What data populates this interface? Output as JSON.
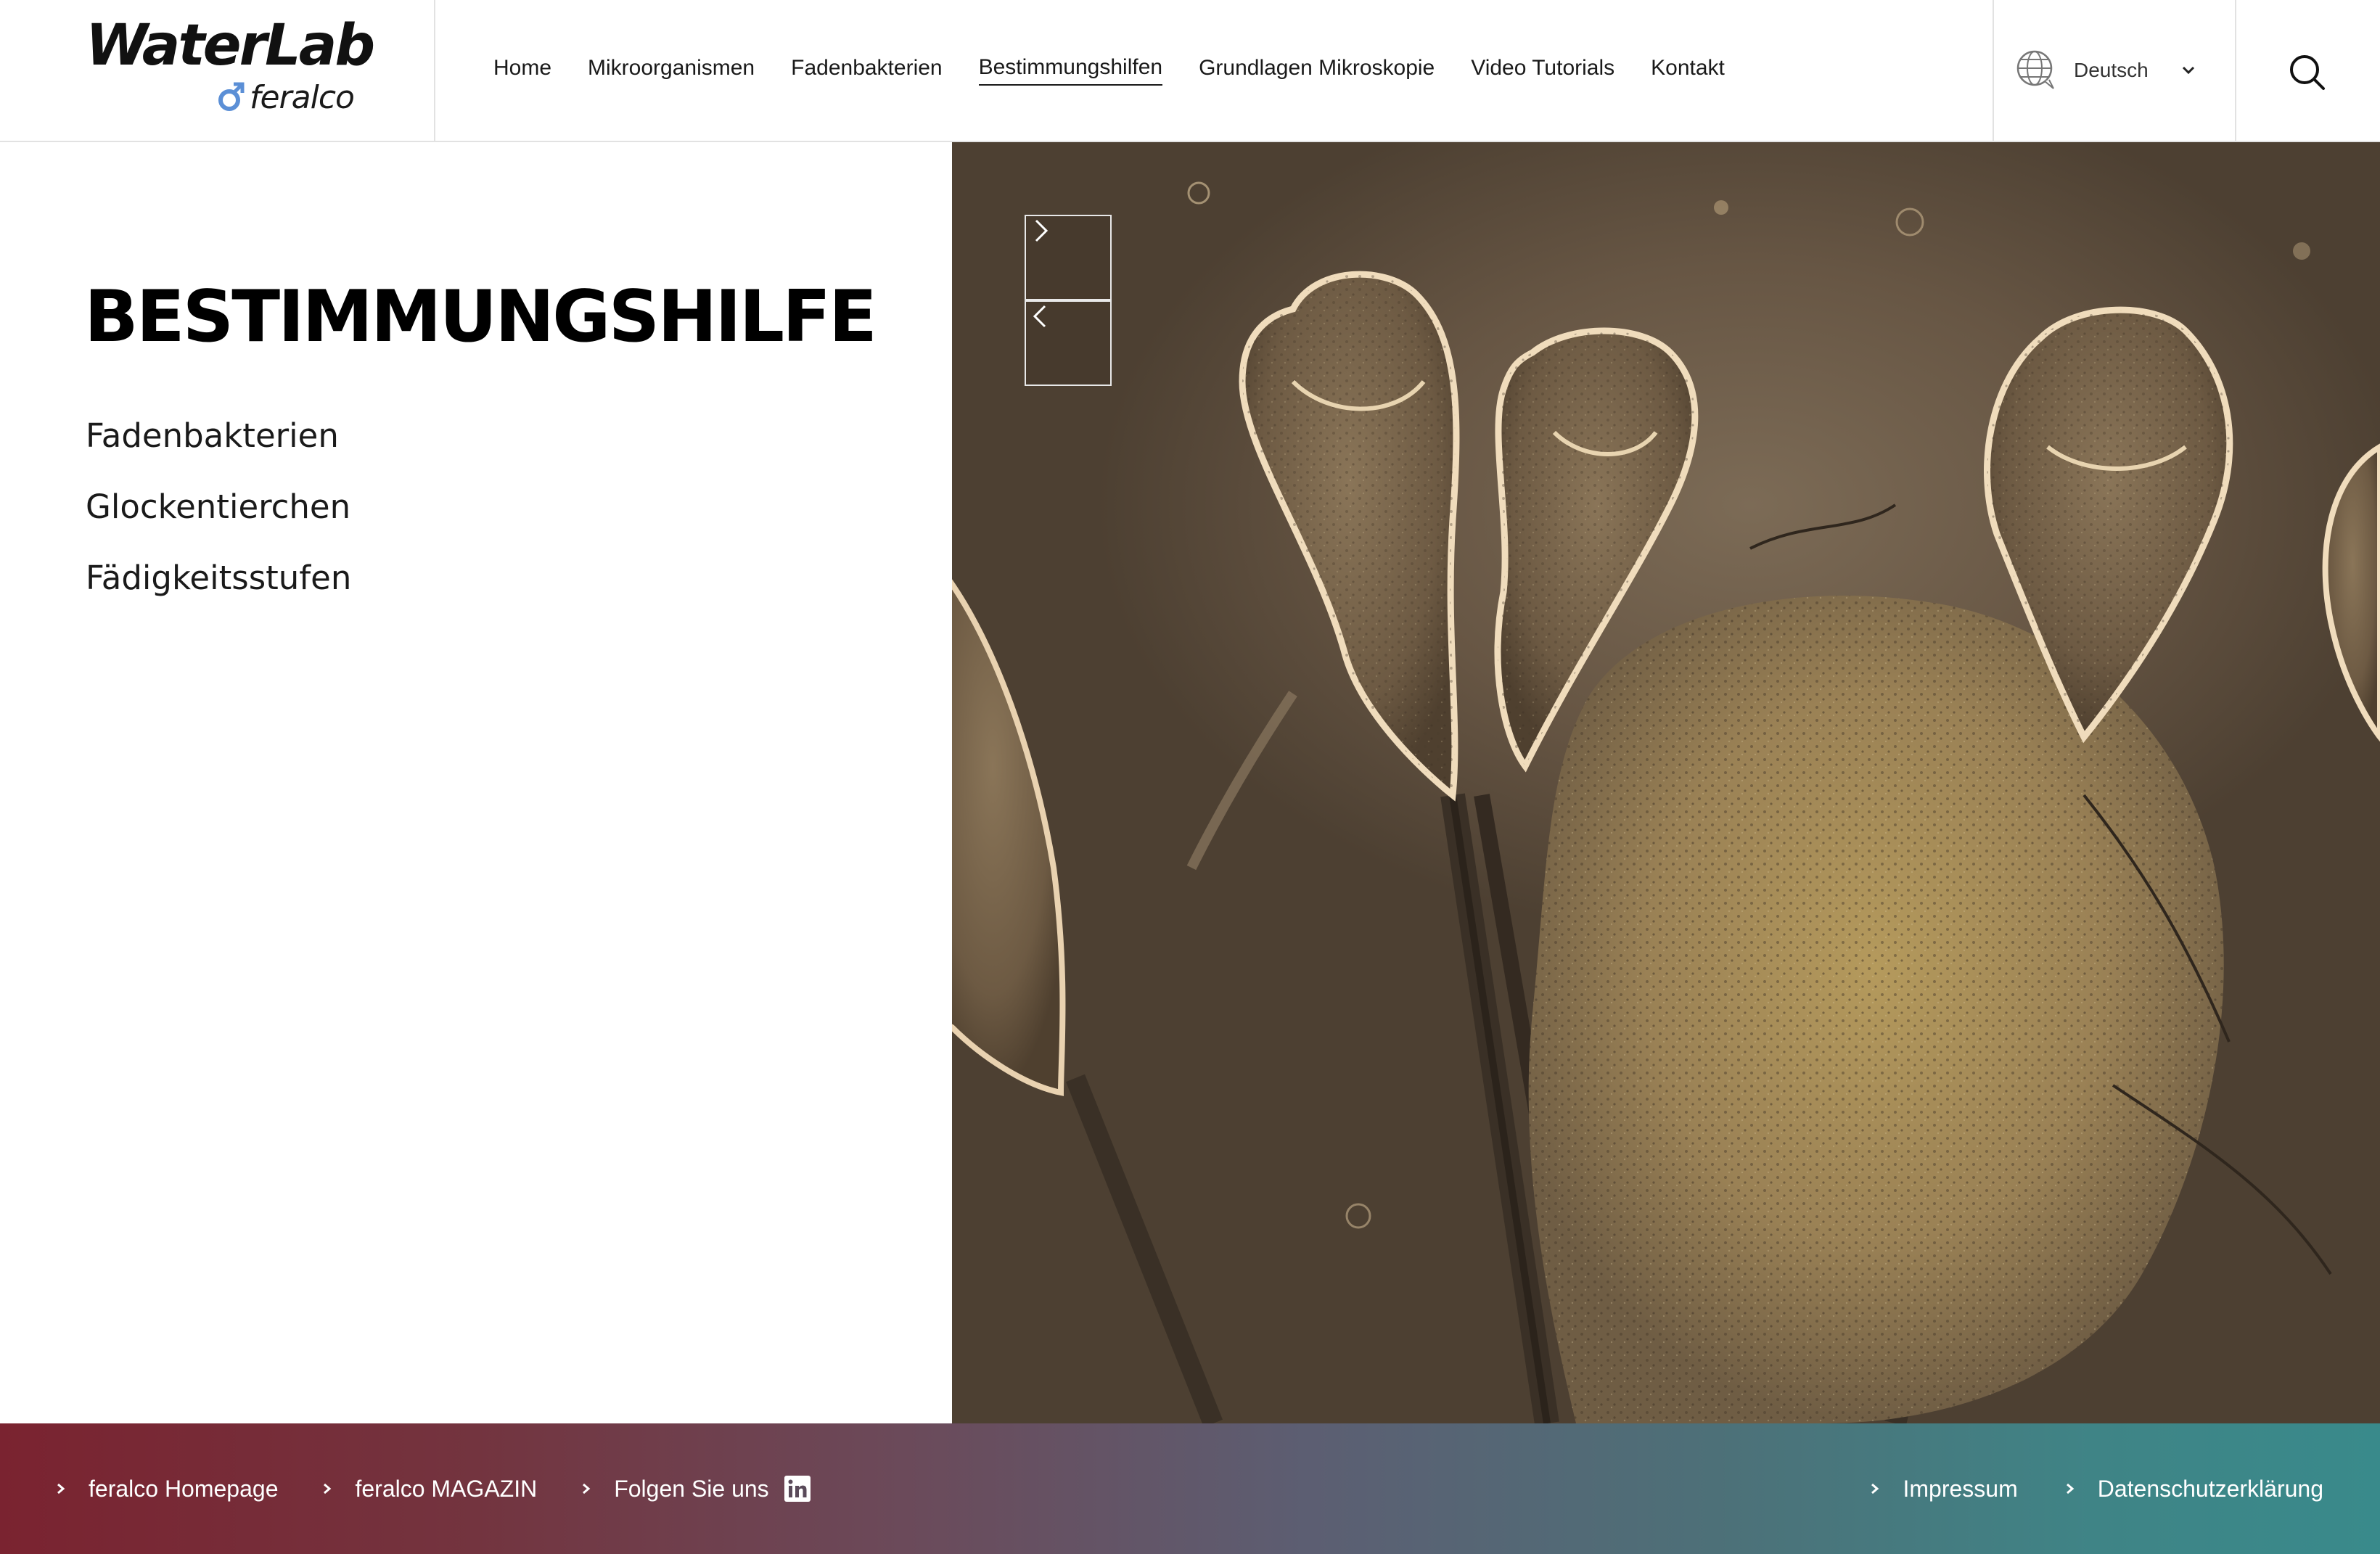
{
  "logo": {
    "main": "WaterLab",
    "sub": "feralco"
  },
  "nav": {
    "items": [
      "Home",
      "Mikroorganismen",
      "Fadenbakterien",
      "Bestimmungshilfen",
      "Grundlagen Mikroskopie",
      "Video Tutorials",
      "Kontakt"
    ],
    "active": "Bestimmungshilfen"
  },
  "language": {
    "selected": "Deutsch"
  },
  "page": {
    "title": "BESTIMMUNGSHILFE",
    "links": [
      "Fadenbakterien",
      "Glockentierchen",
      "Fädigkeitsstufen"
    ]
  },
  "footer": {
    "left": [
      "feralco Homepage",
      "feralco MAGAZIN",
      "Folgen Sie uns"
    ],
    "right": [
      "Impressum",
      "Datenschutzerklärung"
    ]
  },
  "colors": {
    "footer_start": "#7a2330",
    "footer_end": "#398a8b",
    "logo_accent": "#5b8fd6",
    "hero_bg": "#675644"
  },
  "icons": [
    "globe-icon",
    "chevron-down-icon",
    "search-icon",
    "chevron-right-icon",
    "chevron-left-icon",
    "linkedin-icon"
  ]
}
